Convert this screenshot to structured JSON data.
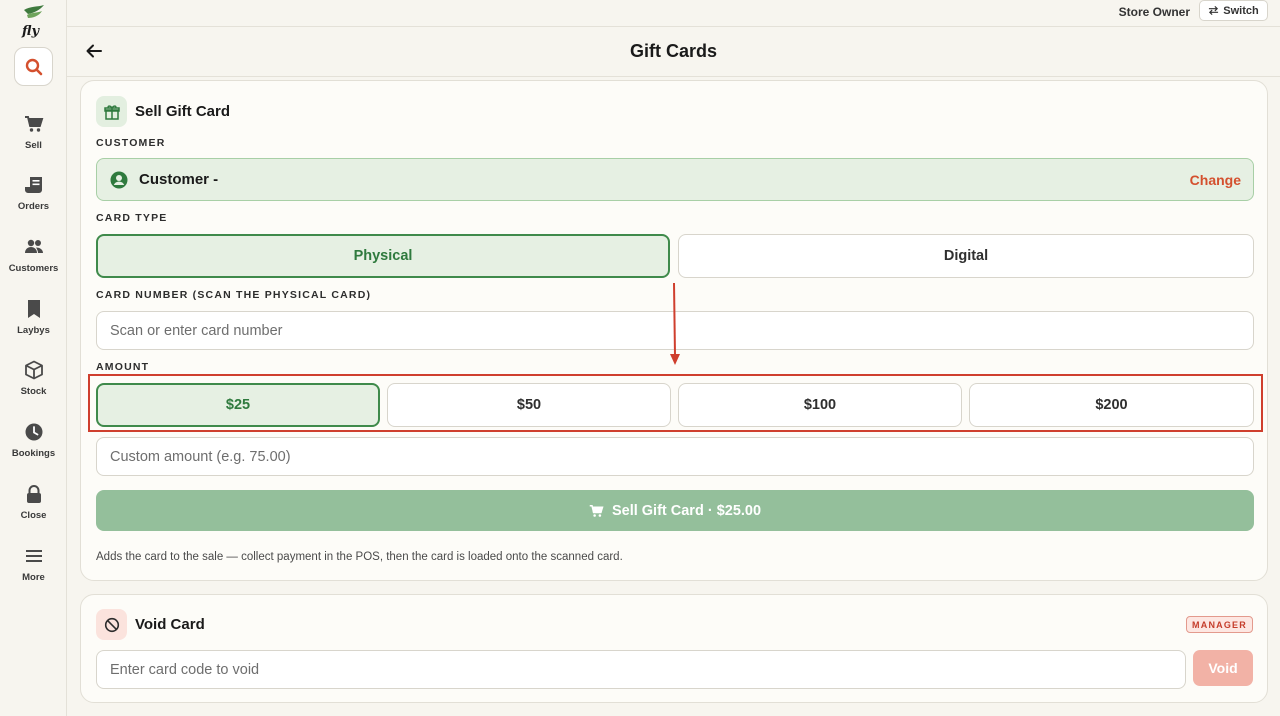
{
  "app": {
    "logo_text": "fly"
  },
  "topbar": {
    "role": "Store Owner",
    "switch_label": "Switch"
  },
  "header": {
    "title": "Gift Cards"
  },
  "sidebar": {
    "items": [
      {
        "label": "Sell",
        "icon": "cart-icon"
      },
      {
        "label": "Orders",
        "icon": "receipt-icon"
      },
      {
        "label": "Customers",
        "icon": "users-icon"
      },
      {
        "label": "Laybys",
        "icon": "bookmark-icon"
      },
      {
        "label": "Stock",
        "icon": "box-icon"
      },
      {
        "label": "Bookings",
        "icon": "clock-icon"
      },
      {
        "label": "Close",
        "icon": "lock-icon"
      },
      {
        "label": "More",
        "icon": "menu-icon"
      }
    ]
  },
  "sell": {
    "title": "Sell Gift Card",
    "customer_label": "CUSTOMER",
    "customer_name": "Customer -",
    "change_label": "Change",
    "card_type_label": "CARD TYPE",
    "card_types": [
      {
        "label": "Physical",
        "selected": true
      },
      {
        "label": "Digital",
        "selected": false
      }
    ],
    "card_number_label": "CARD NUMBER (SCAN THE PHYSICAL CARD)",
    "card_number_placeholder": "Scan or enter card number",
    "amount_label": "AMOUNT",
    "amounts": [
      {
        "label": "$25",
        "selected": true
      },
      {
        "label": "$50",
        "selected": false
      },
      {
        "label": "$100",
        "selected": false
      },
      {
        "label": "$200",
        "selected": false
      }
    ],
    "custom_amount_placeholder": "Custom amount (e.g. 75.00)",
    "submit_label": "Sell Gift Card · $25.00",
    "helper": "Adds the card to the sale — collect payment in the POS, then the card is loaded onto the scanned card."
  },
  "void": {
    "title": "Void Card",
    "badge": "MANAGER",
    "placeholder": "Enter card code to void",
    "button_label": "Void"
  },
  "colors": {
    "accent_green": "#3f8a4b",
    "selected_bg": "#e6f0e3",
    "danger": "#d4502e",
    "button_green": "#94bf9b"
  }
}
